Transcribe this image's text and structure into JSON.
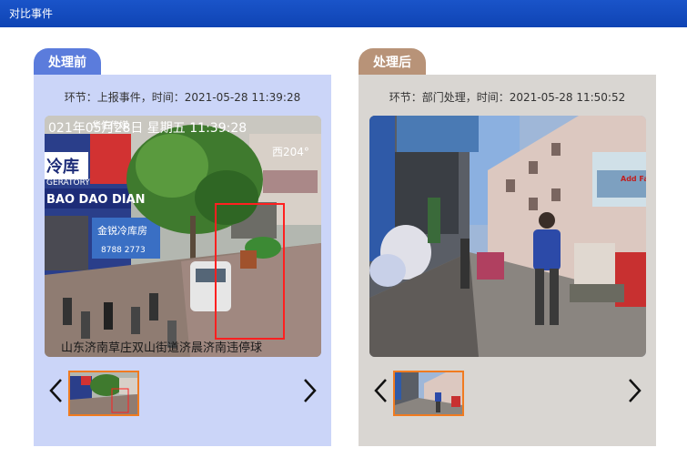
{
  "window": {
    "title": "对比事件"
  },
  "before": {
    "tab_label": "处理前",
    "caption": "环节：上报事件，时间：2021-05-28 11:39:28",
    "overlay": {
      "top_left": "021年05月28日 星期五 11:39:28",
      "top_right": "西204°",
      "shop_sign_1": "冷库",
      "shop_sign_2": "GERATORY",
      "shop_sign_3": "BAO DAO DIAN",
      "shop_sign_4": "华佑传媒",
      "shop_sign_5": "金锐冷库房",
      "shop_sign_6": "8788 2773",
      "bottom": "山东济南草庄双山街道济晨济南违停球"
    }
  },
  "after": {
    "tab_label": "处理后",
    "caption": "环节：部门处理，时间：2021-05-28 11:50:52",
    "overlay": {
      "sign": "Add Fan"
    }
  },
  "colors": {
    "titlebar": "#1a54c9",
    "tab_before": "#5b7cdc",
    "tab_after": "#b89378",
    "panel_before": "#cbd5f8",
    "panel_after": "#d9d6d2",
    "thumb_border": "#f07b20",
    "annotation_box": "#ff2020"
  }
}
